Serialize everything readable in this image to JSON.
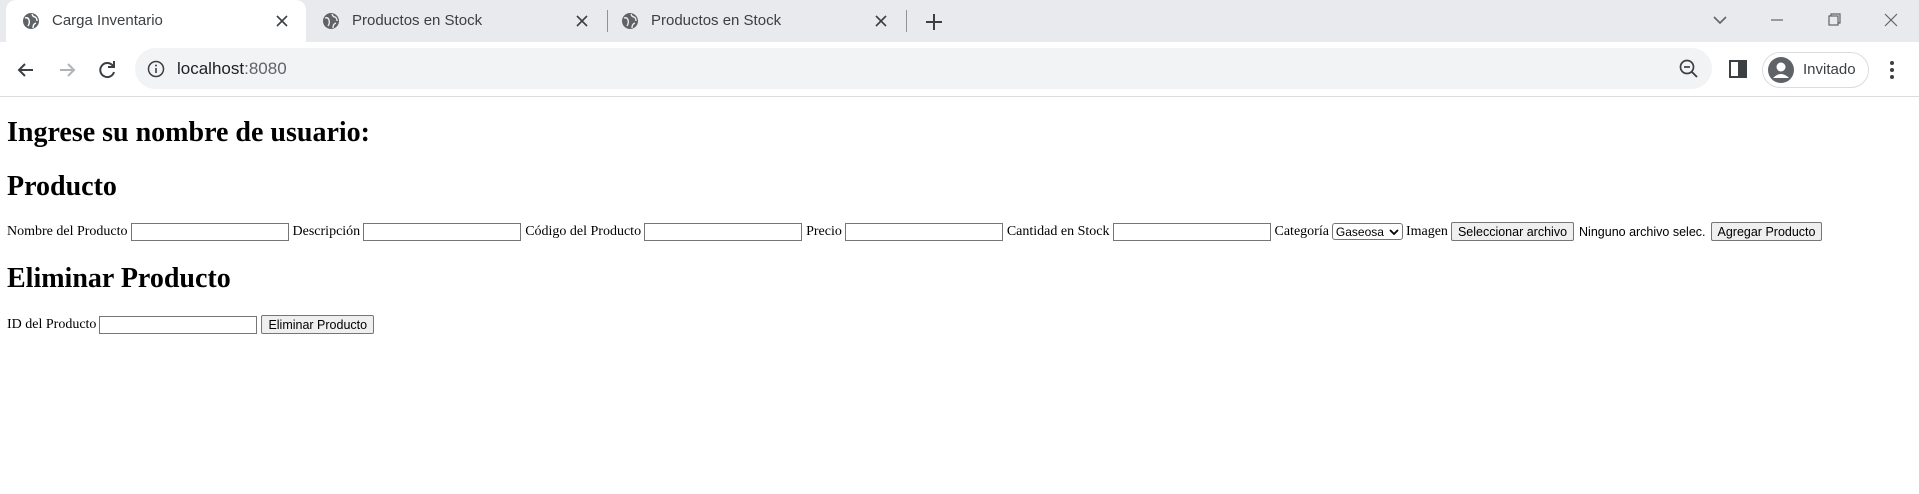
{
  "browser": {
    "tabs": [
      {
        "title": "Carga Inventario",
        "active": true
      },
      {
        "title": "Productos en Stock",
        "active": false
      },
      {
        "title": "Productos en Stock",
        "active": false
      }
    ],
    "url_host": "localhost",
    "url_port": ":8080",
    "profile_name": "Invitado"
  },
  "page": {
    "user_heading": "Ingrese su nombre de usuario:",
    "product_heading": "Producto",
    "product_form": {
      "name_label": "Nombre del Producto",
      "description_label": "Descripción",
      "code_label": "Código del Producto",
      "price_label": "Precio",
      "stock_label": "Cantidad en Stock",
      "category_label": "Categoría",
      "category_selected": "Gaseosa",
      "image_label": "Imagen",
      "file_button": "Seleccionar archivo",
      "file_status": "Ninguno archivo selec.",
      "submit_button": "Agregar Producto"
    },
    "delete_heading": "Eliminar Producto",
    "delete_form": {
      "id_label": "ID del Producto",
      "submit_button": "Eliminar Producto"
    }
  },
  "colors": {
    "tabstrip_bg": "#e8eaed",
    "omnibox_bg": "#f1f3f4",
    "icon_gray": "#5f6368"
  }
}
